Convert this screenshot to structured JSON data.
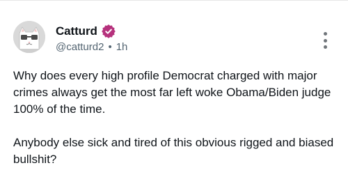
{
  "author": {
    "display_name": "Catturd",
    "handle": "@catturd2",
    "separator": "•",
    "time_ago": "1h",
    "verified": true,
    "verified_color": "#b6327d",
    "avatar_icon": "cat-with-glasses-avatar"
  },
  "post": {
    "paragraphs": [
      "Why does every high profile Democrat charged with major crimes always get the most far left woke Obama/Biden judge 100% of the time.",
      "Anybody else sick and tired of this obvious rigged and biased bullshit?"
    ]
  },
  "actions": {
    "more_icon": "vertical-ellipsis-icon"
  }
}
